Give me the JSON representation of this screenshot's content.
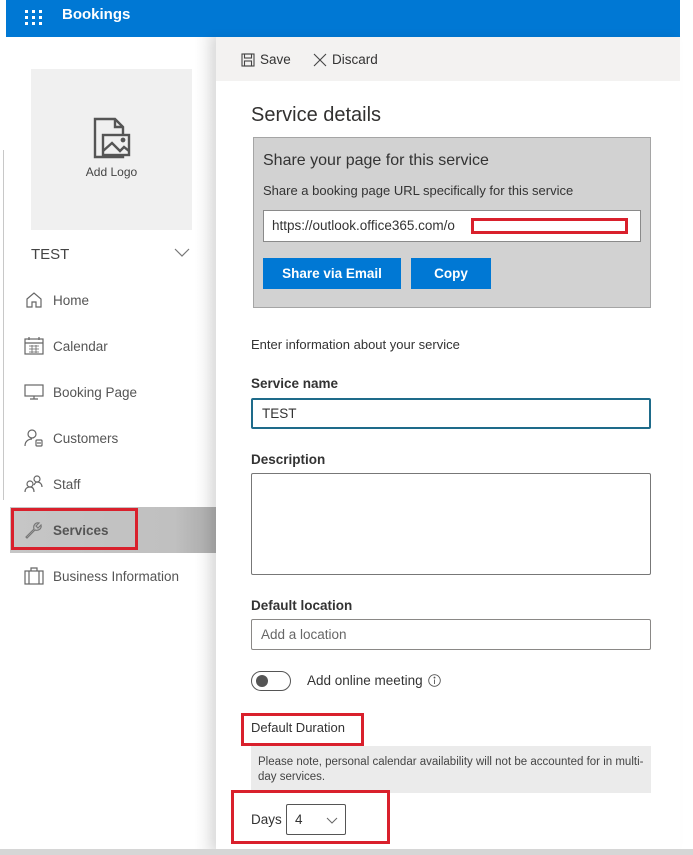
{
  "app": {
    "title": "Bookings",
    "waffle_icon": "app-launcher-icon",
    "brand_color": "#0078d4"
  },
  "sidebar": {
    "logo_label": "Add Logo",
    "business_name": "TEST",
    "items": [
      {
        "label": "Home",
        "icon": "home-icon"
      },
      {
        "label": "Calendar",
        "icon": "calendar-icon"
      },
      {
        "label": "Booking Page",
        "icon": "monitor-icon"
      },
      {
        "label": "Customers",
        "icon": "customers-icon"
      },
      {
        "label": "Staff",
        "icon": "staff-icon"
      },
      {
        "label": "Services",
        "icon": "wrench-icon",
        "active": true
      },
      {
        "label": "Business Information",
        "icon": "briefcase-icon"
      }
    ]
  },
  "toolbar": {
    "save_label": "Save",
    "discard_label": "Discard"
  },
  "panel": {
    "title": "Service details",
    "share": {
      "title": "Share your page for this service",
      "subtitle": "Share a booking page URL specifically for this service",
      "url_value": "https://outlook.office365.com/o",
      "share_email_label": "Share via Email",
      "copy_label": "Copy"
    },
    "intro": "Enter information about your service",
    "service_name": {
      "label": "Service name",
      "value": "TEST"
    },
    "description": {
      "label": "Description",
      "value": ""
    },
    "location": {
      "label": "Default location",
      "placeholder": "Add a location"
    },
    "online_meeting": {
      "label": "Add online meeting",
      "enabled": false
    },
    "duration": {
      "label": "Default Duration",
      "note": "Please note, personal calendar availability will not be accounted for in multi-day services.",
      "days_label": "Days",
      "days_value": "4"
    }
  },
  "annotations": {
    "highlight_color": "#d9202c"
  }
}
